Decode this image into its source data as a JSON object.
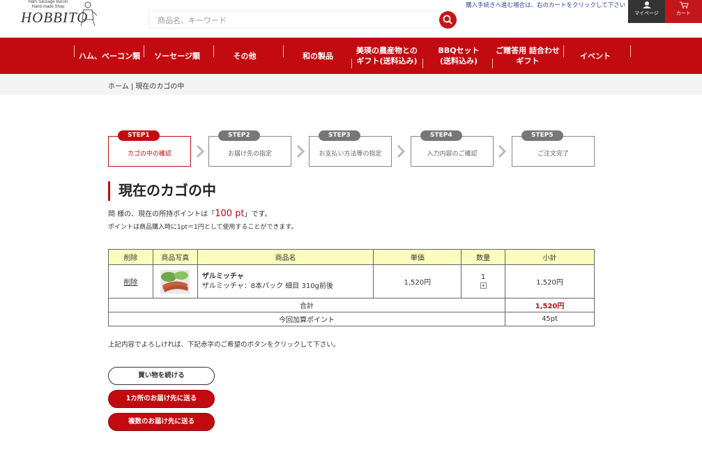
{
  "header": {
    "logo_small": "Ham Sausage Bacon\nHand-made Shop",
    "logo_main": "HOBBITO",
    "search_placeholder": "商品名、キーワード",
    "note": "購入手続きへ進む場合は、右のカートをクリックして下さい",
    "mypage": "マイページ",
    "cart": "カート"
  },
  "nav": [
    "ハム、ベーコン類",
    "ソーセージ類",
    "その他",
    "和の製品",
    "美瑛の農産物との\nギフト(送料込み)",
    "BBQセット\n(送料込み)",
    "ご贈答用 詰合わせ\nギフト",
    "イベント"
  ],
  "breadcrumb": "ホーム | 現在のカゴの中",
  "steps": [
    {
      "badge": "STEP1",
      "label": "カゴの中の確認"
    },
    {
      "badge": "STEP2",
      "label": "お届け先の指定"
    },
    {
      "badge": "STEP3",
      "label": "お支払い方法等の指定"
    },
    {
      "badge": "STEP4",
      "label": "入力内容のご確認"
    },
    {
      "badge": "STEP5",
      "label": "ご注文完了"
    }
  ],
  "title": "現在のカゴの中",
  "points": {
    "prefix": "岡 様の、現在の所持ポイントは「",
    "value": "100 pt",
    "suffix": "」です。",
    "note": "ポイントは商品購入時に1pt＝1円として使用することができます。"
  },
  "table": {
    "headers": [
      "削除",
      "商品写真",
      "商品名",
      "単価",
      "数量",
      "小計"
    ],
    "row": {
      "delete": "削除",
      "name": "ザルミッチャ",
      "detail": "ザルミッチャ：8本パック 細目 310g前後",
      "price": "1,520円",
      "qty": "1",
      "subtotal": "1,520円"
    },
    "total_label": "合計",
    "total_value": "1,520円",
    "points_label": "今回加算ポイント",
    "points_value": "45pt"
  },
  "confirm_note": "上記内容でよろしければ、下記赤字のご希望のボタンをクリックして下さい。",
  "buttons": {
    "continue": "買い物を続ける",
    "single": "1カ所のお届け先に送る",
    "multiple": "複数のお届け先に送る"
  },
  "colors": {
    "brand": "#c10b11",
    "table_header": "#fefbbe"
  }
}
